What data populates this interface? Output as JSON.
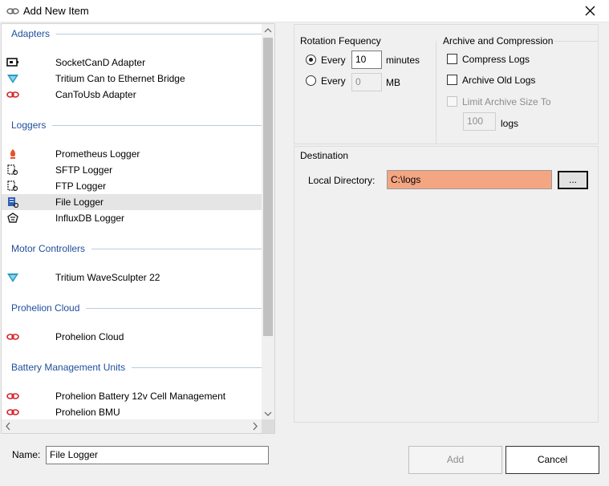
{
  "window": {
    "title": "Add New Item"
  },
  "list": {
    "groups": [
      {
        "title": "Adapters",
        "items": [
          {
            "label": "SocketCanD Adapter",
            "icon": "socketcand-icon"
          },
          {
            "label": "Tritium Can to Ethernet Bridge",
            "icon": "tritium-icon"
          },
          {
            "label": "CanToUsb Adapter",
            "icon": "link-icon"
          }
        ]
      },
      {
        "title": "Loggers",
        "items": [
          {
            "label": "Prometheus Logger",
            "icon": "prometheus-flame-icon"
          },
          {
            "label": "SFTP Logger",
            "icon": "document-gear-icon"
          },
          {
            "label": "FTP Logger",
            "icon": "document-gear-icon"
          },
          {
            "label": "File Logger",
            "icon": "file-logger-icon",
            "selected": true
          },
          {
            "label": "InfluxDB Logger",
            "icon": "influxdb-icon"
          }
        ]
      },
      {
        "title": "Motor Controllers",
        "items": [
          {
            "label": "Tritium WaveSculpter 22",
            "icon": "tritium-icon"
          }
        ]
      },
      {
        "title": "Prohelion Cloud",
        "items": [
          {
            "label": "Prohelion Cloud",
            "icon": "link-icon"
          }
        ]
      },
      {
        "title": "Battery Management Units",
        "items": [
          {
            "label": "Prohelion Battery 12v Cell Management",
            "icon": "link-icon"
          },
          {
            "label": "Prohelion BMU",
            "icon": "link-icon"
          }
        ]
      }
    ]
  },
  "rotation": {
    "title": "Rotation Fequency",
    "option1": {
      "prefix": "Every",
      "value": "10",
      "unit": "minutes",
      "checked": true
    },
    "option2": {
      "prefix": "Every",
      "value": "0",
      "unit": "MB",
      "checked": false
    }
  },
  "archive": {
    "title": "Archive and Compression",
    "compress_label": "Compress Logs",
    "archive_old_label": "Archive Old Logs",
    "limit_label": "Limit Archive Size To",
    "limit_value": "100",
    "limit_unit": "logs"
  },
  "destination": {
    "title": "Destination",
    "local_dir_label": "Local Directory:",
    "local_dir_value": "C:\\logs",
    "browse_label": "...",
    "highlight_color": "#f4a582"
  },
  "footer": {
    "name_label": "Name:",
    "name_value": "File Logger",
    "add_label": "Add",
    "cancel_label": "Cancel"
  }
}
